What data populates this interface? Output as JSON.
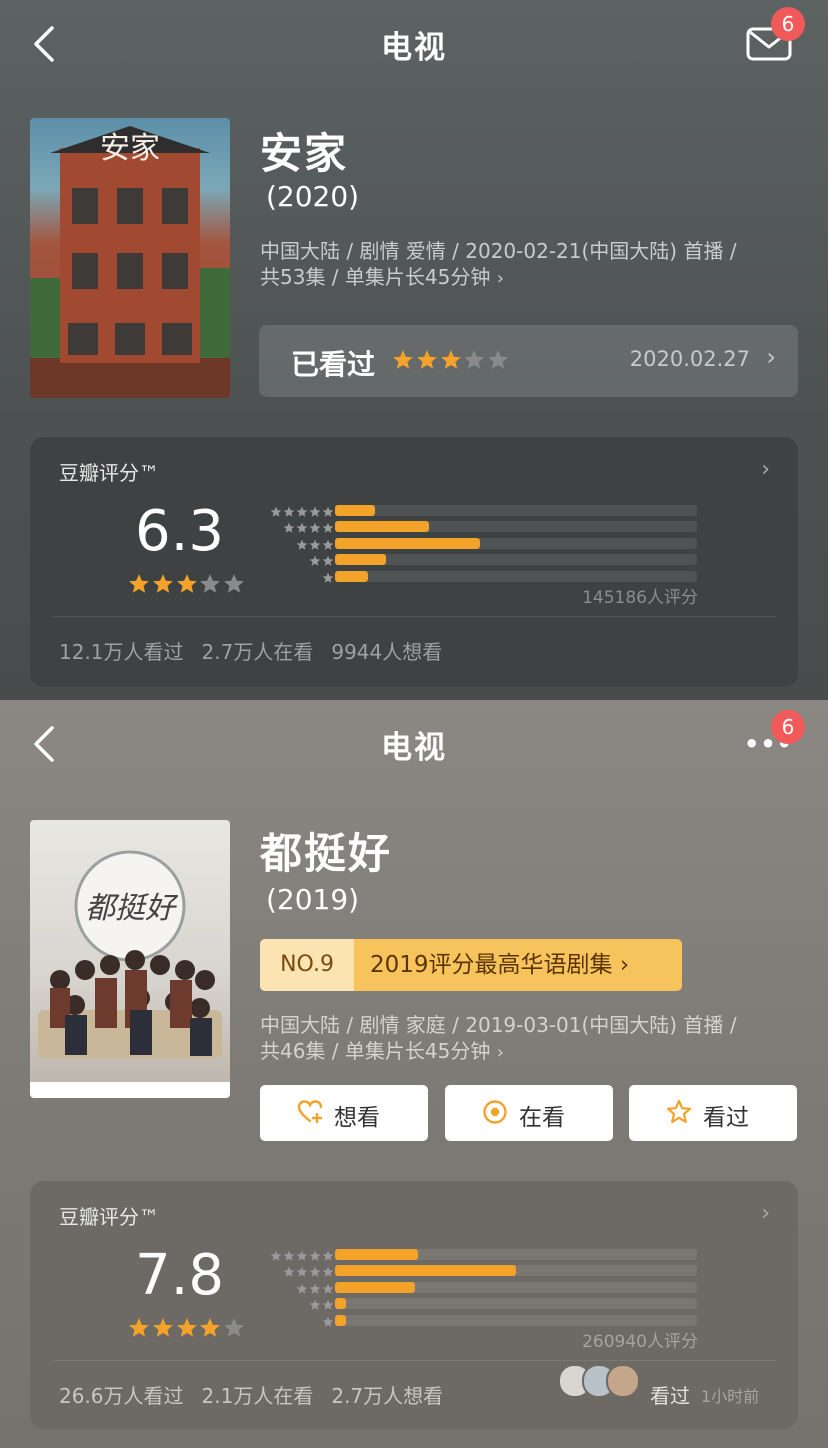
{
  "screen1": {
    "nav": {
      "title": "电视",
      "badge": "6"
    },
    "movie": {
      "title": "安家",
      "year": "(2020)",
      "poster_text": "安家",
      "meta_line1": "中国大陆 / 剧情 爱情 / 2020-02-21(中国大陆) 首播 /",
      "meta_line2": "共53集 / 单集片长45分钟",
      "meta_chevron": "›"
    },
    "watched": {
      "label": "已看过",
      "stars": 3,
      "date": "2020.02.27",
      "chevron": "›"
    },
    "rating": {
      "header": "豆瓣评分™",
      "chevron": "›",
      "score": "6.3",
      "stars": 3,
      "bars": [
        0.11,
        0.26,
        0.4,
        0.14,
        0.09
      ],
      "count": "145186人评分",
      "stats": [
        "12.1万人看过",
        "2.7万人在看",
        "9944人想看"
      ]
    }
  },
  "screen2": {
    "nav": {
      "title": "电视",
      "badge": "6",
      "more": "•••"
    },
    "movie": {
      "title": "都挺好",
      "year": "(2019)",
      "poster_text": "都挺好",
      "meta_line1": "中国大陆 / 剧情 家庭 / 2019-03-01(中国大陆) 首播 /",
      "meta_line2": "共46集 / 单集片长45分钟",
      "meta_chevron": "›"
    },
    "rank": {
      "no": "NO.9",
      "text": "2019评分最高华语剧集 ›"
    },
    "actions": [
      {
        "label": "想看",
        "icon": "heart-plus-icon"
      },
      {
        "label": "在看",
        "icon": "target-icon"
      },
      {
        "label": "看过",
        "icon": "star-outline-icon"
      }
    ],
    "rating": {
      "header": "豆瓣评分™",
      "chevron": "›",
      "score": "7.8",
      "stars": 4,
      "bars": [
        0.23,
        0.5,
        0.22,
        0.03,
        0.03
      ],
      "count": "260940人评分",
      "stats": [
        "26.6万人看过",
        "2.1万人在看",
        "2.7万人想看"
      ],
      "friend_label": "看过",
      "friend_time": "1小时前"
    }
  },
  "colors": {
    "accent": "#f3a22a",
    "badge": "#f05a5a",
    "rank_bg": "#f7c35c"
  }
}
